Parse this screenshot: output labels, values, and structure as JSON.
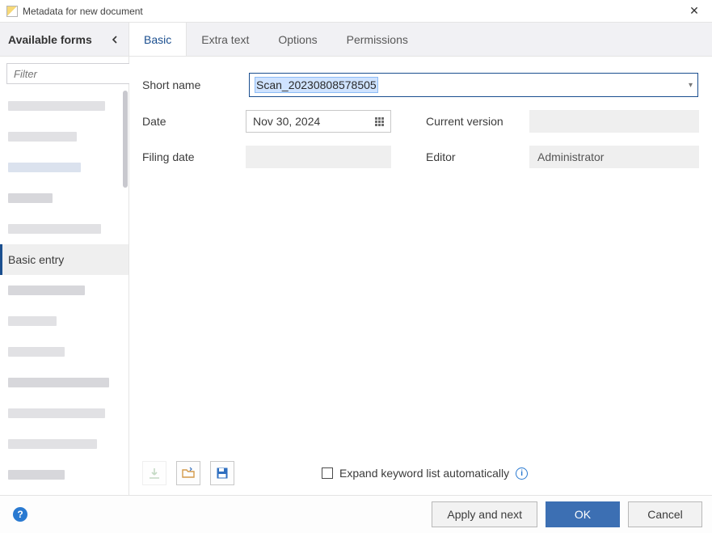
{
  "window": {
    "title": "Metadata for new document"
  },
  "sidebar": {
    "header": "Available forms",
    "filter_placeholder": "Filter",
    "selected_label": "Basic entry"
  },
  "tabs": [
    {
      "id": "basic",
      "label": "Basic",
      "active": true
    },
    {
      "id": "extra",
      "label": "Extra text",
      "active": false
    },
    {
      "id": "options",
      "label": "Options",
      "active": false
    },
    {
      "id": "permissions",
      "label": "Permissions",
      "active": false
    }
  ],
  "form": {
    "short_name_label": "Short name",
    "short_name_value": "Scan_20230808578505",
    "date_label": "Date",
    "date_value": "Nov 30, 2024",
    "current_version_label": "Current version",
    "current_version_value": "",
    "filing_date_label": "Filing date",
    "filing_date_value": "",
    "editor_label": "Editor",
    "editor_value": "Administrator",
    "expand_keyword_label": "Expand keyword list automatically",
    "expand_keyword_checked": false
  },
  "footer": {
    "apply_next": "Apply and next",
    "ok": "OK",
    "cancel": "Cancel"
  }
}
